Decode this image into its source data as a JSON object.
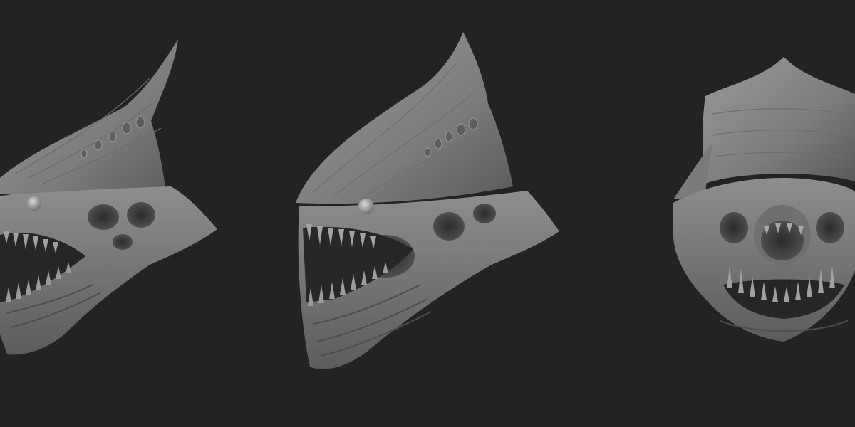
{
  "scene": {
    "background_color": "#232323",
    "material_color": "#8a8a8a",
    "views": [
      {
        "name": "left-profile-view"
      },
      {
        "name": "three-quarter-view"
      },
      {
        "name": "front-view"
      }
    ]
  }
}
